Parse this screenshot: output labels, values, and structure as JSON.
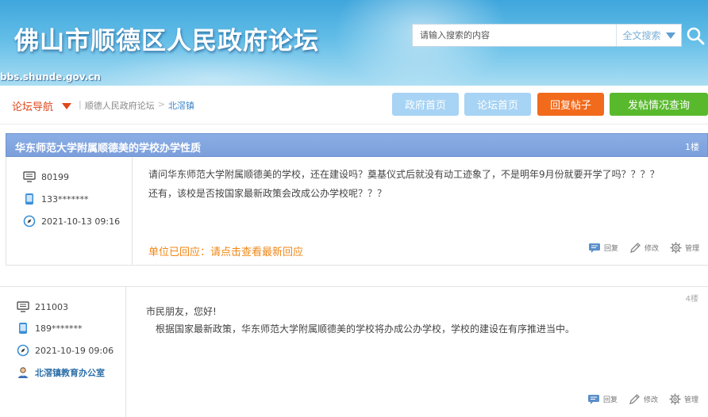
{
  "header": {
    "site_title": "佛山市顺德区人民政府论坛",
    "domain": "bbs.shunde.gov.cn",
    "search_placeholder": "请输入搜索的内容",
    "search_type": "全文搜索"
  },
  "nav": {
    "label": "论坛导航",
    "breadcrumb": [
      "顺德人民政府论坛",
      ">",
      "北滘镇"
    ],
    "buttons": {
      "gov_home": "政府首页",
      "forum_home": "论坛首页",
      "reply_post": "回复帖子",
      "post_status": "发帖情况查询"
    }
  },
  "colors": {
    "accent_blue": "#7c9fdc",
    "reply_orange": "#f26a1c",
    "status_green": "#59b92d",
    "light_blue": "#a7d3f4"
  },
  "post1": {
    "title": "华东师范大学附属顺德美的学校办学性质",
    "floor": "1楼",
    "user_id": "80199",
    "phone": "133*******",
    "date": "2021-10-13 09:16",
    "lines": [
      "请问华东师范大学附属顺德美的学校，还在建设吗？奠基仪式后就没有动工迹象了，不是明年9月份就要开学了吗？？？？",
      "还有，该校是否按国家最新政策会改成公办学校呢？？？"
    ],
    "answered_link": "单位已回应：请点击查看最新回应",
    "actions": {
      "reply": "回复",
      "edit": "修改",
      "manage": "管理"
    }
  },
  "post2": {
    "floor": "4楼",
    "user_id": "211003",
    "phone": "189*******",
    "date": "2021-10-19 09:06",
    "department": "北滘镇教育办公室",
    "lines": [
      "市民朋友，您好!",
      "根据国家最新政策，华东师范大学附属顺德美的学校将办成公办学校，学校的建设在有序推进当中。"
    ],
    "actions": {
      "reply": "回复",
      "edit": "修改",
      "manage": "管理"
    }
  }
}
